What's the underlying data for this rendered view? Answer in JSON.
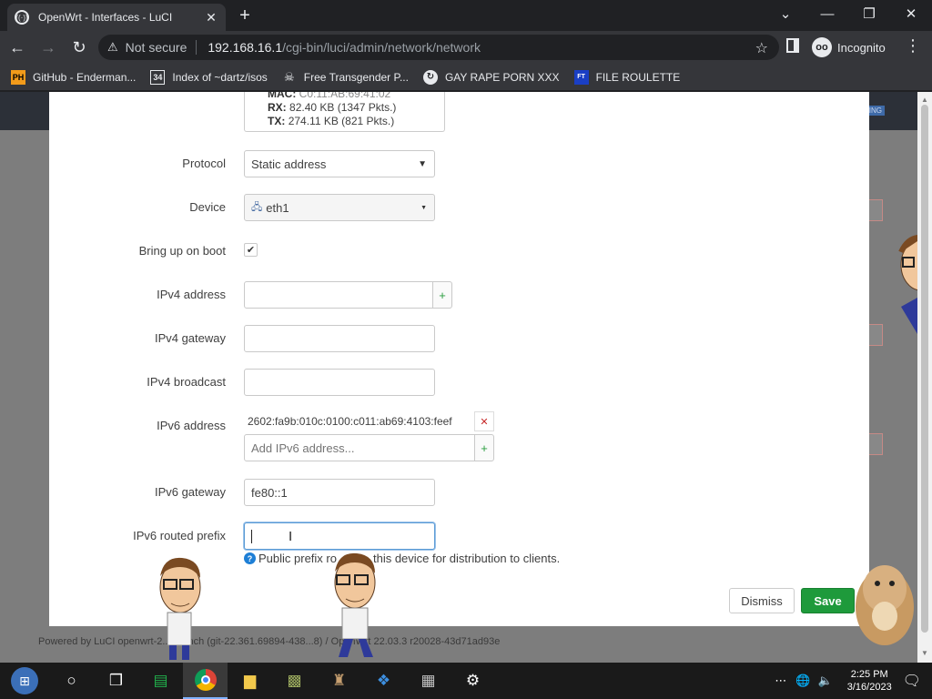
{
  "browser": {
    "tab_title": "OpenWrt - Interfaces - LuCI",
    "address": {
      "security_label": "Not secure",
      "host": "192.168.16.1",
      "path": "/cgi-bin/luci/admin/network/network"
    },
    "incognito_label": "Incognito",
    "bookmarks": [
      {
        "label": "GitHub - Enderman...",
        "icon": "PH"
      },
      {
        "label": "Index of ~dartz/isos",
        "icon": "34"
      },
      {
        "label": "Free Transgender P...",
        "icon": "skull"
      },
      {
        "label": "GAY RAPE PORN XXX",
        "icon": "circle-arrow"
      },
      {
        "label": "FILE ROULETTE",
        "icon": "FT"
      }
    ]
  },
  "status_card": {
    "mac_label": "MAC:",
    "mac_value": "C0:11:AB:69:41:02",
    "rx_label": "RX:",
    "rx_value": "82.40 KB (1347 Pkts.)",
    "tx_label": "TX:",
    "tx_value": "274.11 KB (821 Pkts.)"
  },
  "form": {
    "protocol": {
      "label": "Protocol",
      "value": "Static address"
    },
    "device": {
      "label": "Device",
      "value": "eth1"
    },
    "bring_up": {
      "label": "Bring up on boot",
      "checked": true
    },
    "ipv4_address": {
      "label": "IPv4 address",
      "value": ""
    },
    "ipv4_gateway": {
      "label": "IPv4 gateway",
      "value": ""
    },
    "ipv4_broadcast": {
      "label": "IPv4 broadcast",
      "value": ""
    },
    "ipv6_address": {
      "label": "IPv6 address",
      "value": "2602:fa9b:010c:0100:c011:ab69:4103:feef",
      "placeholder": "Add IPv6 address..."
    },
    "ipv6_gateway": {
      "label": "IPv6 gateway",
      "value": "fe80::1"
    },
    "ipv6_prefix": {
      "label": "IPv6 routed prefix",
      "value": "",
      "hint_a": "Public prefix ro",
      "hint_b": "this device for distribution to clients."
    }
  },
  "buttons": {
    "dismiss": "Dismiss",
    "save": "Save"
  },
  "footer": "Powered by LuCI openwrt-2... branch (git-22.361.69894-438...8) / OpenWrt 22.03.3 r20028-43d71ad93e",
  "taskbar": {
    "time": "2:25 PM",
    "date": "3/16/2023"
  },
  "colors": {
    "save": "#1e9a3b",
    "link": "#1e7fd6"
  }
}
